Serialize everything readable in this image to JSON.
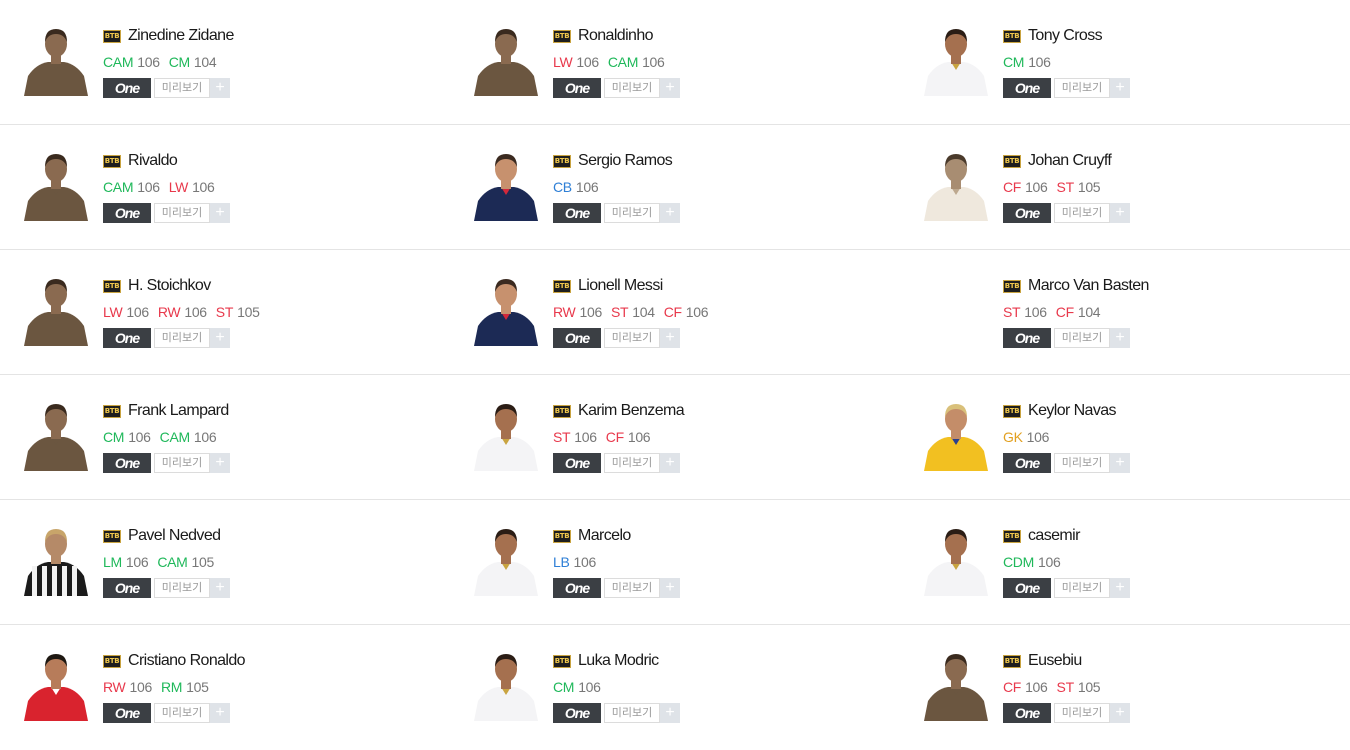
{
  "colors": {
    "mid": "#1fb85a",
    "fwd": "#e8394c",
    "def": "#2e7fd6",
    "gk": "#e2a020"
  },
  "labels": {
    "season": "BTB",
    "one": "One",
    "preview": "미리보기",
    "plus": "+"
  },
  "players": [
    {
      "name": "Zinedine Zidane",
      "photo": "sepia",
      "positions": [
        {
          "code": "CAM",
          "ovr": "106",
          "group": "mid"
        },
        {
          "code": "CM",
          "ovr": "104",
          "group": "mid"
        }
      ]
    },
    {
      "name": "Ronaldinho",
      "photo": "sepia",
      "positions": [
        {
          "code": "LW",
          "ovr": "106",
          "group": "fwd"
        },
        {
          "code": "CAM",
          "ovr": "106",
          "group": "mid"
        }
      ]
    },
    {
      "name": "Tony Cross",
      "photo": "white-kit",
      "positions": [
        {
          "code": "CM",
          "ovr": "106",
          "group": "mid"
        }
      ]
    },
    {
      "name": "Rivaldo",
      "photo": "sepia",
      "positions": [
        {
          "code": "CAM",
          "ovr": "106",
          "group": "mid"
        },
        {
          "code": "LW",
          "ovr": "106",
          "group": "fwd"
        }
      ]
    },
    {
      "name": "Sergio Ramos",
      "photo": "navy-kit",
      "positions": [
        {
          "code": "CB",
          "ovr": "106",
          "group": "def"
        }
      ]
    },
    {
      "name": "Johan Cruyff",
      "photo": "sepia-light",
      "positions": [
        {
          "code": "CF",
          "ovr": "106",
          "group": "fwd"
        },
        {
          "code": "ST",
          "ovr": "105",
          "group": "fwd"
        }
      ]
    },
    {
      "name": "H. Stoichkov",
      "photo": "sepia",
      "positions": [
        {
          "code": "LW",
          "ovr": "106",
          "group": "fwd"
        },
        {
          "code": "RW",
          "ovr": "106",
          "group": "fwd"
        },
        {
          "code": "ST",
          "ovr": "105",
          "group": "fwd"
        }
      ]
    },
    {
      "name": "Lionell Messi",
      "photo": "navy-kit",
      "positions": [
        {
          "code": "RW",
          "ovr": "106",
          "group": "fwd"
        },
        {
          "code": "ST",
          "ovr": "104",
          "group": "fwd"
        },
        {
          "code": "CF",
          "ovr": "106",
          "group": "fwd"
        }
      ]
    },
    {
      "name": "Marco Van Basten",
      "photo": "none",
      "positions": [
        {
          "code": "ST",
          "ovr": "106",
          "group": "fwd"
        },
        {
          "code": "CF",
          "ovr": "104",
          "group": "fwd"
        }
      ]
    },
    {
      "name": "Frank Lampard",
      "photo": "sepia",
      "positions": [
        {
          "code": "CM",
          "ovr": "106",
          "group": "mid"
        },
        {
          "code": "CAM",
          "ovr": "106",
          "group": "mid"
        }
      ]
    },
    {
      "name": "Karim Benzema",
      "photo": "white-kit",
      "positions": [
        {
          "code": "ST",
          "ovr": "106",
          "group": "fwd"
        },
        {
          "code": "CF",
          "ovr": "106",
          "group": "fwd"
        }
      ]
    },
    {
      "name": "Keylor Navas",
      "photo": "yellow-kit",
      "positions": [
        {
          "code": "GK",
          "ovr": "106",
          "group": "gk"
        }
      ]
    },
    {
      "name": "Pavel Nedved",
      "photo": "stripes",
      "positions": [
        {
          "code": "LM",
          "ovr": "106",
          "group": "mid"
        },
        {
          "code": "CAM",
          "ovr": "105",
          "group": "mid"
        }
      ]
    },
    {
      "name": "Marcelo",
      "photo": "white-kit",
      "positions": [
        {
          "code": "LB",
          "ovr": "106",
          "group": "def"
        }
      ]
    },
    {
      "name": "casemir",
      "photo": "white-kit",
      "positions": [
        {
          "code": "CDM",
          "ovr": "106",
          "group": "mid"
        }
      ]
    },
    {
      "name": "Cristiano Ronaldo",
      "photo": "red-kit",
      "positions": [
        {
          "code": "RW",
          "ovr": "106",
          "group": "fwd"
        },
        {
          "code": "RM",
          "ovr": "105",
          "group": "mid"
        }
      ]
    },
    {
      "name": "Luka Modric",
      "photo": "white-kit",
      "positions": [
        {
          "code": "CM",
          "ovr": "106",
          "group": "mid"
        }
      ]
    },
    {
      "name": "Eusebiu",
      "photo": "sepia",
      "positions": [
        {
          "code": "CF",
          "ovr": "106",
          "group": "fwd"
        },
        {
          "code": "ST",
          "ovr": "105",
          "group": "fwd"
        }
      ]
    }
  ]
}
